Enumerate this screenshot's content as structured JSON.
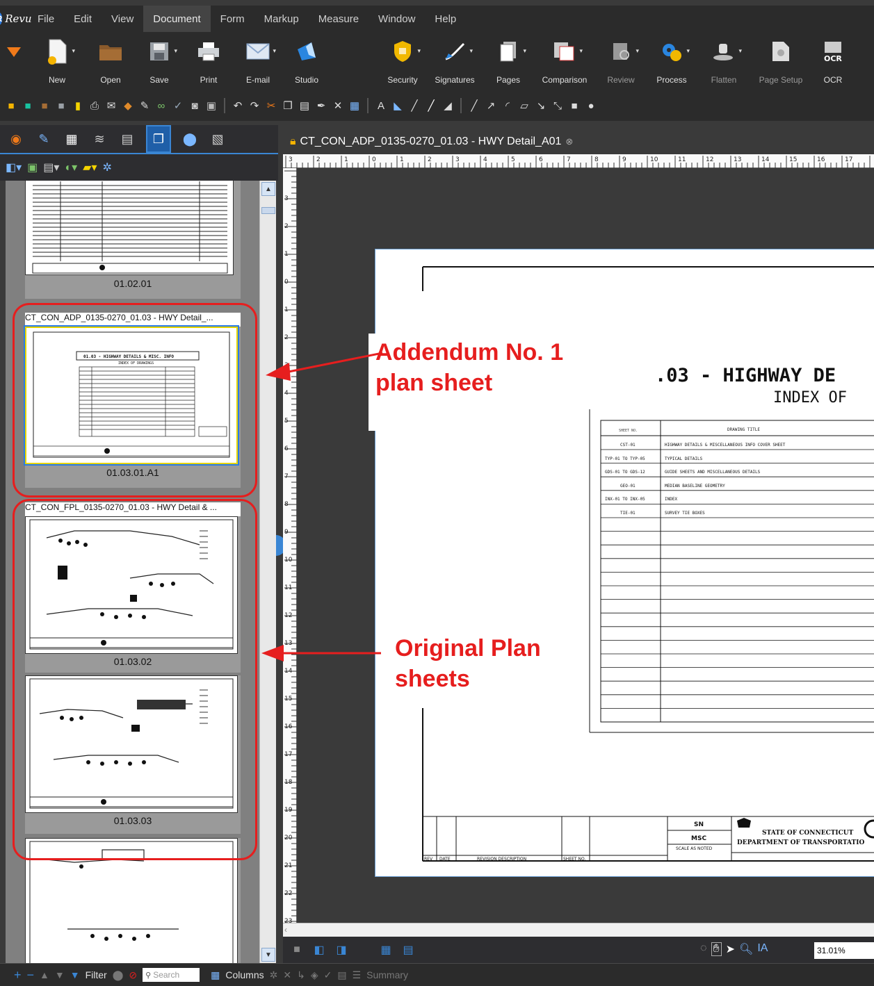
{
  "app": {
    "logo_text": "Revu"
  },
  "menu": [
    "File",
    "Edit",
    "View",
    "Document",
    "Form",
    "Markup",
    "Measure",
    "Window",
    "Help"
  ],
  "toolbar": {
    "buttons": [
      {
        "label": "New"
      },
      {
        "label": "Open"
      },
      {
        "label": "Save"
      },
      {
        "label": "Print"
      },
      {
        "label": "E-mail"
      },
      {
        "label": "Studio"
      },
      {
        "label": "Security"
      },
      {
        "label": "Signatures"
      },
      {
        "label": "Pages"
      },
      {
        "label": "Comparison"
      },
      {
        "label": "Review"
      },
      {
        "label": "Process"
      },
      {
        "label": "Flatten"
      },
      {
        "label": "Page Setup"
      },
      {
        "label": "OCR"
      }
    ]
  },
  "document": {
    "tab_title": "CT_CON_ADP_0135-0270_01.03 - HWY Detail_A01",
    "sheet_heading": ".03 - HIGHWAY DE",
    "sheet_subheading": "INDEX OF",
    "table_header": {
      "col1": "SHEET NO.",
      "col2": "DRAWING TITLE"
    },
    "table_rows": [
      {
        "no": "CST-01",
        "title": "HIGHWAY DETAILS & MISCELLANEOUS INFO COVER SHEET"
      },
      {
        "no": "TYP-01 TO TYP-05",
        "title": "TYPICAL DETAILS"
      },
      {
        "no": "GDS-01 TO GDS-12",
        "title": "GUIDE SHEETS AND MISCELLANEOUS DETAILS"
      },
      {
        "no": "GEO-01",
        "title": "MEDIAN BASELINE GEOMETRY"
      },
      {
        "no": "INX-01 TO INX-05",
        "title": "INDEX"
      },
      {
        "no": "TIE-01",
        "title": "SURVEY TIE BOXES"
      }
    ],
    "titleblock": {
      "rev": "REV",
      "date": "DATE",
      "revision_description": "REVISION DESCRIPTION",
      "sheet_no": "SHEET NO.",
      "drafter": "SN",
      "checker": "MSC",
      "scale": "SCALE AS NOTED",
      "agency_line1": "STATE OF CONNECTICUT",
      "agency_line2": "DEPARTMENT OF TRANSPORTATIO"
    }
  },
  "ruler": {
    "h_ticks": [
      "3",
      "2",
      "1",
      "0",
      "1",
      "2",
      "3",
      "4",
      "5",
      "6",
      "7",
      "8",
      "9",
      "10",
      "11",
      "12",
      "13",
      "14",
      "15",
      "16",
      "17"
    ],
    "v_ticks": [
      "3",
      "2",
      "1",
      "0",
      "1",
      "2",
      "3",
      "4",
      "5",
      "6",
      "7",
      "8",
      "9",
      "10",
      "11",
      "12",
      "13",
      "14",
      "15",
      "16",
      "17",
      "18",
      "19",
      "20",
      "21",
      "22",
      "23"
    ]
  },
  "thumbnails": {
    "items": [
      {
        "label": "01.02.01"
      },
      {
        "group_title": "CT_CON_ADP_0135-0270_01.03 - HWY Detail_...",
        "label": "01.03.01.A1",
        "mini_heading": "01.03 - HIGHWAY DETAILS & MISC. INFO",
        "mini_sub": "INDEX OF DRAWINGS"
      },
      {
        "group_title": "CT_CON_FPL_0135-0270_01.03 - HWY Detail & ...",
        "label": "01.03.02"
      },
      {
        "label": "01.03.03"
      }
    ]
  },
  "status": {
    "zoom": "31.01%"
  },
  "bottombar": {
    "filter": "Filter",
    "search_placeholder": "Search",
    "columns": "Columns",
    "summary": "Summary"
  },
  "annotations": {
    "addendum_line1": "Addendum No. 1",
    "addendum_line2": "plan sheet",
    "original_line1": "Original Plan",
    "original_line2": "sheets",
    "color": "#e61e1e"
  }
}
